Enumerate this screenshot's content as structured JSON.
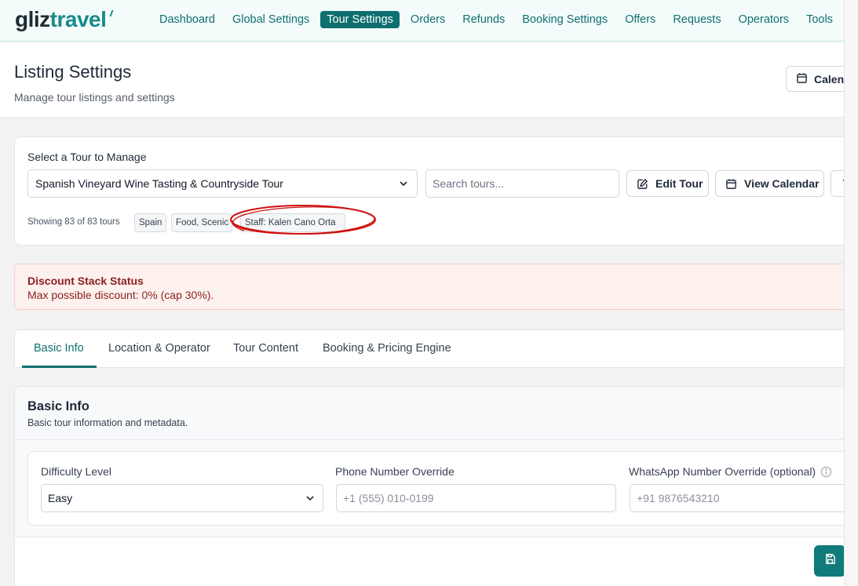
{
  "brand": {
    "logo_left": "gliz",
    "logo_right": "travel"
  },
  "nav": {
    "items": [
      {
        "label": "Dashboard",
        "active": false
      },
      {
        "label": "Global Settings",
        "active": false
      },
      {
        "label": "Tour Settings",
        "active": true
      },
      {
        "label": "Orders",
        "active": false
      },
      {
        "label": "Refunds",
        "active": false
      },
      {
        "label": "Booking Settings",
        "active": false
      },
      {
        "label": "Offers",
        "active": false
      },
      {
        "label": "Requests",
        "active": false
      },
      {
        "label": "Operators",
        "active": false
      },
      {
        "label": "Tools",
        "active": false
      }
    ]
  },
  "header": {
    "title": "Listing Settings",
    "subtitle": "Manage tour listings and settings",
    "calendar_button": "Calend"
  },
  "tour_select": {
    "label": "Select a Tour to Manage",
    "selected": "Spanish Vineyard Wine Tasting & Countryside Tour",
    "search_placeholder": "Search tours...",
    "edit_button": "Edit Tour",
    "view_calendar_button": "View Calendar",
    "showing": "Showing 83 of 83 tours",
    "chips": {
      "country": "Spain",
      "categories": "Food, Scenic",
      "staff": "Staff: Kalen Cano Orta"
    }
  },
  "discount": {
    "title": "Discount Stack Status",
    "body": "Max possible discount: 0% (cap 30%)."
  },
  "tabs": [
    {
      "label": "Basic Info",
      "active": true
    },
    {
      "label": "Location & Operator",
      "active": false
    },
    {
      "label": "Tour Content",
      "active": false
    },
    {
      "label": "Booking & Pricing Engine",
      "active": false
    }
  ],
  "basic_info": {
    "title": "Basic Info",
    "description": "Basic tour information and metadata.",
    "difficulty_label": "Difficulty Level",
    "difficulty_value": "Easy",
    "phone_label": "Phone Number Override",
    "phone_placeholder": "+1 (555) 010-0199",
    "whatsapp_label": "WhatsApp Number Override (optional)",
    "whatsapp_placeholder": "+91 9876543210"
  },
  "colors": {
    "accent": "#0f6f6f",
    "alert_text": "#8a1f1f",
    "alert_bg": "#fdf1ee",
    "annotation": "#d01010"
  }
}
